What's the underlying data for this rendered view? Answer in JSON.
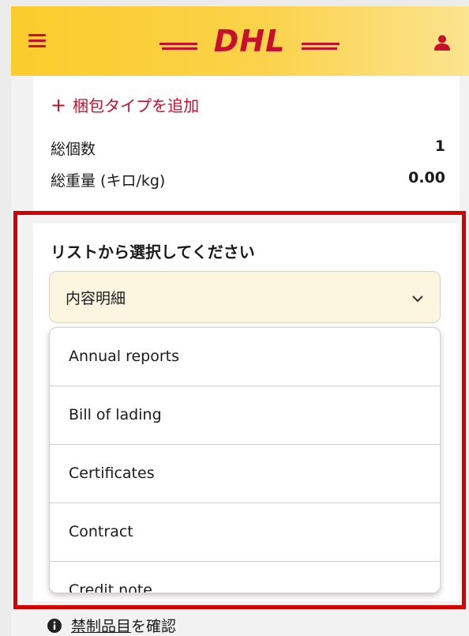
{
  "colors": {
    "brand_yellow": "#fbcc2b",
    "brand_red": "#c8102e",
    "highlight_red": "#d40000",
    "select_bg": "#fcf5e0"
  },
  "header": {
    "logo_text": "DHL",
    "menu_icon": "hamburger-menu-icon",
    "user_icon": "user-icon"
  },
  "summary": {
    "add_package_label": "梱包タイプを追加",
    "total_pieces_label": "総個数",
    "total_pieces_value": "1",
    "total_weight_label": "総重量 (キロ/kg)",
    "total_weight_value": "0.00"
  },
  "select": {
    "heading": "リストから選択してください",
    "selected_value": "内容明細",
    "options": [
      "Annual reports",
      "Bill of lading",
      "Certificates",
      "Contract",
      "Credit note"
    ]
  },
  "footer": {
    "link_text": "禁制品目",
    "suffix_text": "を確認"
  }
}
